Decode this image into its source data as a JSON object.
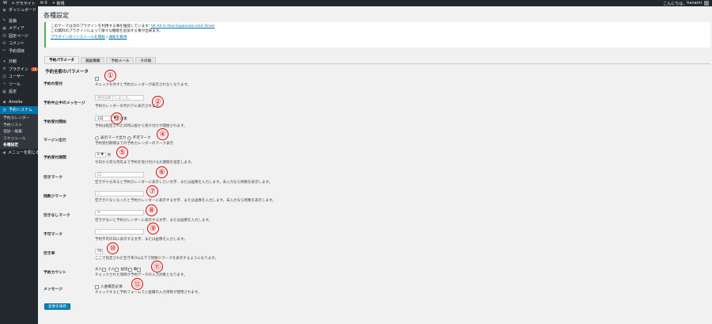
{
  "adminbar": {
    "wp_logo": "W",
    "site_icon": "⌂",
    "site_name": "デモサイト",
    "comments_icon": "✉",
    "comments_count": "0",
    "new_icon": "+",
    "new_label": "新規",
    "greeting": "こんにちは、",
    "user_name": "hanami"
  },
  "sidebar": {
    "items_top": [
      {
        "icon": "◉",
        "label": "ダッシュボード"
      }
    ],
    "items_mid": [
      {
        "icon": "✎",
        "label": "投稿"
      },
      {
        "icon": "▣",
        "label": "メディア"
      },
      {
        "icon": "▤",
        "label": "固定ページ"
      },
      {
        "icon": "✉",
        "label": "コメント"
      },
      {
        "icon": "✂",
        "label": "予約項目"
      }
    ],
    "items_lower": [
      {
        "icon": "✦",
        "label": "外観"
      },
      {
        "icon": "⚙",
        "label": "プラグイン",
        "badge": "16"
      },
      {
        "icon": "☺",
        "label": "ユーザー"
      },
      {
        "icon": "✧",
        "label": "ツール"
      },
      {
        "icon": "▦",
        "label": "設定"
      }
    ],
    "items_plugins": [
      {
        "icon": "◆",
        "label": "Amelia"
      },
      {
        "icon": "◷",
        "label": "予約システム"
      }
    ],
    "submenu": [
      "予約カレンダー",
      "予約リスト",
      "追加・編集",
      "スケジュール",
      "各種設定"
    ],
    "collapse_icon": "◀",
    "collapse_label": "メニューを閉じる"
  },
  "page": {
    "title": "各種設定",
    "notice": {
      "line1": "このテーマは次のプラグインを利用する事を推奨しています: ",
      "plugin_link": "VK All in One Expansion Unit (Free)",
      "line2": "この無料のプラグインによって様々な機能を追加する事が出来ます。",
      "install_link": "プラグインのインストールを開始",
      "separator": "|",
      "dismiss_link": "通知を無視"
    },
    "tabs": [
      "予約パラメータ",
      "施設情報",
      "予約メール",
      "その他"
    ],
    "section_title": "予約全般のパラメータ",
    "save_label": "変更を保存"
  },
  "form": {
    "accept": {
      "label": "予約の受付",
      "desc": "チェックを外すと予約カレンダーが表示されなくなります。"
    },
    "stop_message": {
      "label": "予約中止中のメッセージ",
      "value": "受付は終了しました。",
      "desc": "予約カレンダーの代わりに表示されます。"
    },
    "start": {
      "label": "予約受付開始",
      "select": "1日",
      "suffix": "以後",
      "desc": "予約は指定された日時以後から受け付けが開始されます。"
    },
    "margin": {
      "label": "マージン出力",
      "opt1": "表示マーク出力",
      "opt2": "不可マーク",
      "desc": "予約受付期間までの予約カレンダーのマーク表示"
    },
    "period": {
      "label": "予約受付期間",
      "select": "6",
      "suffix": "月",
      "desc": "今日から何カ月先まで予約を受け付けるか期間を指定します。"
    },
    "vacant": {
      "label": "空きマーク",
      "value": "◯",
      "desc": "空きが十分あると予約カレンダーに表示したい文字、または画像を入力します。未入力なら残数を表示します。"
    },
    "few": {
      "label": "残数少マーク",
      "value": "△",
      "desc": "空きが少なくなったと予約カレンダーに表示する文字、または画像を入力します。未入力なら残数を表示します。"
    },
    "full": {
      "label": "空きなしマーク",
      "value": "×",
      "desc": "空きがないと予約カレンダーに表示する文字、または画像を入力します。"
    },
    "disabled": {
      "label": "不可マーク",
      "value": "－",
      "desc": "予約不可の日に表示する文字、または画像を入力します。"
    },
    "rate": {
      "label": "空き率",
      "value": "50",
      "desc": "ここで指定された空き率(%)以下で残数少マークを表示するようになります。"
    },
    "count": {
      "label": "予約カウント",
      "opts": [
        "大人",
        "小人",
        "幼児",
        "車"
      ],
      "desc": "チェックされた項目が予約データの入力対象となります。"
    },
    "message": {
      "label": "メッセージ",
      "opt": "入金確定必須",
      "desc": "チェックすると予約フォームで入金欄の入力項目が使用されます。"
    }
  },
  "markers": [
    "①",
    "②",
    "③",
    "④",
    "⑤",
    "⑥",
    "⑦",
    "⑧",
    "⑨",
    "⑩",
    "⑪",
    "⑫"
  ],
  "colors": {
    "accent": "#0073aa",
    "marker": "#dd0000",
    "sidebar": "#23282d",
    "notice_border": "#46b450"
  }
}
